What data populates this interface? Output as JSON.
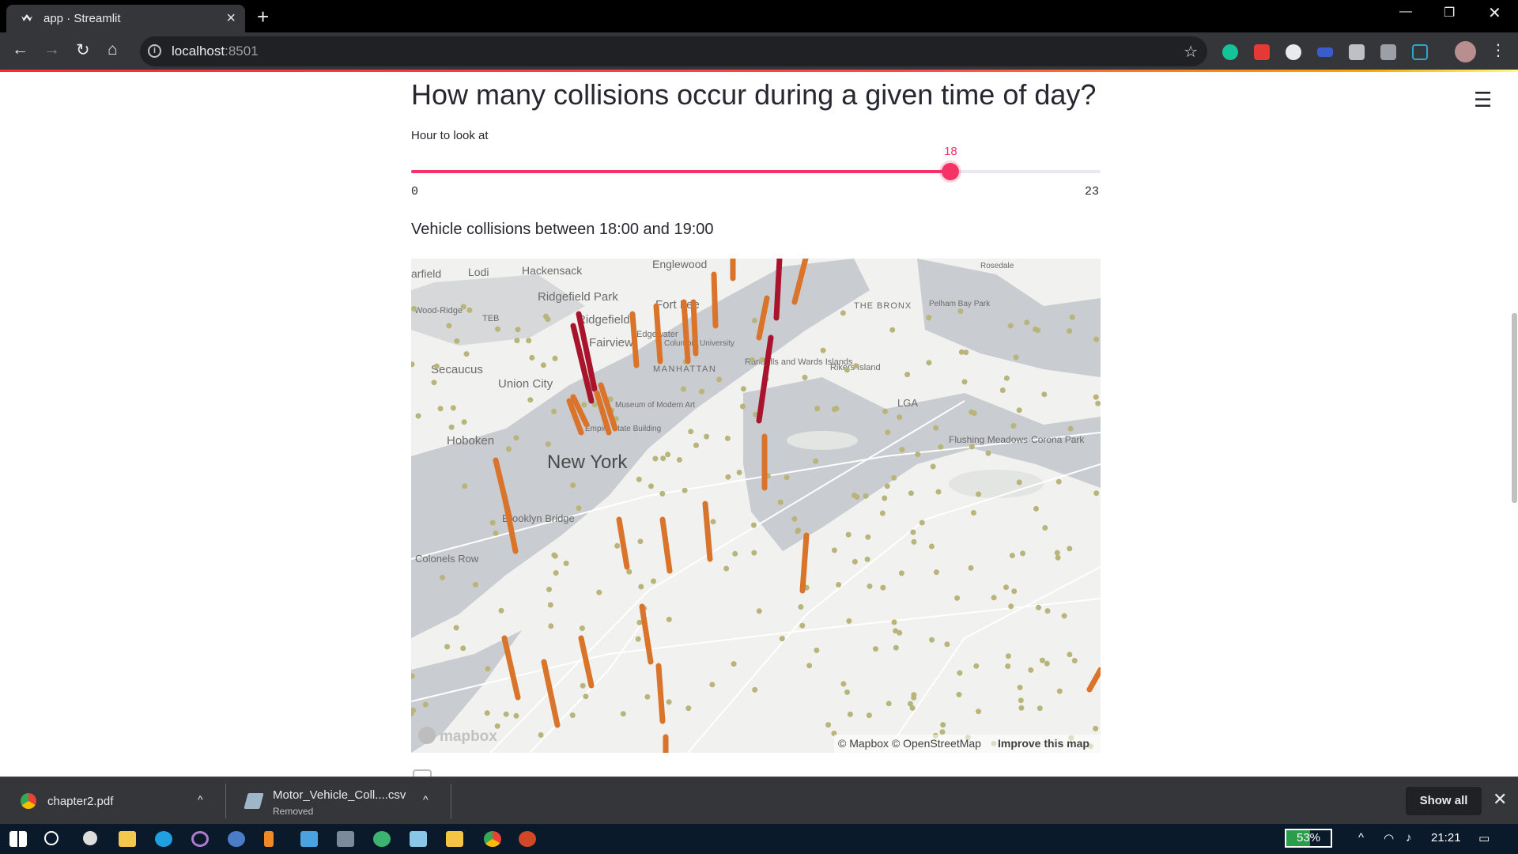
{
  "browser": {
    "tab_title": "app · Streamlit",
    "url_host": "localhost",
    "url_port": ":8501"
  },
  "page": {
    "heading": "How many collisions occur during a given time of day?",
    "slider": {
      "label": "Hour to look at",
      "min": 0,
      "max": 23,
      "value": 18,
      "min_label": "0",
      "max_label": "23",
      "value_label": "18"
    },
    "subtitle": "Vehicle collisions between 18:00 and 19:00",
    "map": {
      "attribution": "© Mapbox © OpenStreetMap",
      "improve": "Improve this map",
      "logo": "mapbox",
      "labels": [
        "arfield",
        "Lodi",
        "Hackensack",
        "Englewood",
        "Rosedale",
        "Wood-Ridge",
        "TEB",
        "Ridgefield Park",
        "Fort Lee",
        "THE BRONX",
        "Pelham Bay Park",
        "Ridgefield",
        "Edgewater",
        "Fairview",
        "Columbia University",
        "Secaucus",
        "Randalls and Wards Islands",
        "Rikers Island",
        "Union City",
        "MANHATTAN",
        "Museum of Modern Art",
        "LGA",
        "Empire State Building",
        "Hoboken",
        "New York",
        "Flushing Meadows-Corona Park",
        "Brooklyn Bridge",
        "Colonels Row"
      ]
    }
  },
  "downloads": {
    "items": [
      {
        "name": "chapter2.pdf",
        "status": ""
      },
      {
        "name": "Motor_Vehicle_Coll....csv",
        "status": "Removed"
      }
    ],
    "show_all": "Show all"
  },
  "taskbar": {
    "battery": "53%",
    "battery_level": 0.53,
    "time": "21:21"
  }
}
